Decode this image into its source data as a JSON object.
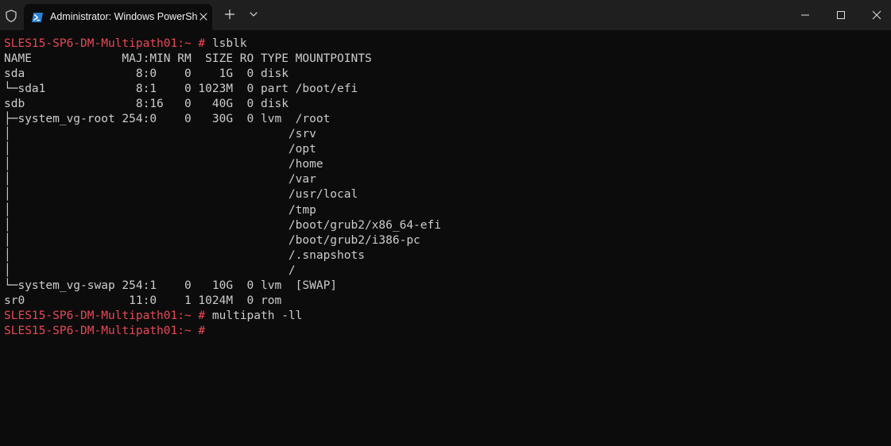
{
  "window": {
    "tab_title": "Administrator: Windows PowerShell",
    "icons": {
      "shield": "shield-icon",
      "tab": "powershell-icon",
      "close_tab": "close-icon",
      "new_tab": "plus-icon",
      "dropdown": "chevron-down-icon",
      "minimize": "minimize-icon",
      "maximize": "maximize-icon",
      "close": "close-icon"
    }
  },
  "terminal": {
    "colors": {
      "background": "#0c0c0c",
      "text": "#cccccc",
      "prompt": "#e74856"
    },
    "blocks": [
      {
        "prompt": "SLES15-SP6-DM-Multipath01:~ #",
        "command": "lsblk"
      },
      {
        "text": "NAME             MAJ:MIN RM  SIZE RO TYPE MOUNTPOINTS"
      },
      {
        "text": "sda                8:0    0    1G  0 disk"
      },
      {
        "text": "└─sda1             8:1    0 1023M  0 part /boot/efi"
      },
      {
        "text": "sdb                8:16   0   40G  0 disk"
      },
      {
        "text": "├─system_vg-root 254:0    0   30G  0 lvm  /root"
      },
      {
        "text": "│                                        /srv"
      },
      {
        "text": "│                                        /opt"
      },
      {
        "text": "│                                        /home"
      },
      {
        "text": "│                                        /var"
      },
      {
        "text": "│                                        /usr/local"
      },
      {
        "text": "│                                        /tmp"
      },
      {
        "text": "│                                        /boot/grub2/x86_64-efi"
      },
      {
        "text": "│                                        /boot/grub2/i386-pc"
      },
      {
        "text": "│                                        /.snapshots"
      },
      {
        "text": "│                                        /"
      },
      {
        "text": "└─system_vg-swap 254:1    0   10G  0 lvm  [SWAP]"
      },
      {
        "text": "sr0               11:0    1 1024M  0 rom"
      },
      {
        "prompt": "SLES15-SP6-DM-Multipath01:~ #",
        "command": "multipath -ll"
      },
      {
        "prompt": "SLES15-SP6-DM-Multipath01:~ #",
        "command": ""
      }
    ]
  }
}
